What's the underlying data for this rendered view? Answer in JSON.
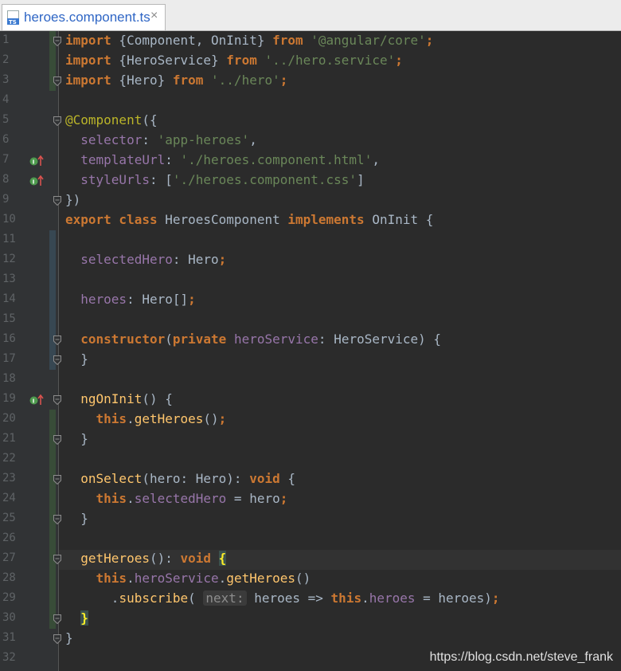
{
  "tab": {
    "filename": "heroes.component.ts",
    "file_icon": "ts-file-icon",
    "close_glyph": "×"
  },
  "watermark": "https://blog.csdn.net/steve_frank",
  "lines": [
    {
      "num": "1",
      "html": "<span class=\"k\">import</span> {Component, OnInit} <span class=\"k\">from</span> <span class=\"s\">'@angular/core'</span><span class=\"k\">;</span>"
    },
    {
      "num": "2",
      "html": "<span class=\"k\">import</span> {HeroService} <span class=\"k\">from</span> <span class=\"s\">'../hero.service'</span><span class=\"k\">;</span>"
    },
    {
      "num": "3",
      "html": "<span class=\"k\">import</span> {Hero} <span class=\"k\">from</span> <span class=\"s\">'../hero'</span><span class=\"k\">;</span>"
    },
    {
      "num": "4",
      "html": ""
    },
    {
      "num": "5",
      "html": "<span class=\"a\">@Component</span>({"
    },
    {
      "num": "6",
      "html": "  <span class=\"v\">selector</span>: <span class=\"s\">'app-heroes'</span>,"
    },
    {
      "num": "7",
      "html": "  <span class=\"v\">templateUrl</span>: <span class=\"s\">'./heroes.component.html'</span>,"
    },
    {
      "num": "8",
      "html": "  <span class=\"v\">styleUrls</span>: [<span class=\"s\">'./heroes.component.css'</span>]"
    },
    {
      "num": "9",
      "html": "})"
    },
    {
      "num": "10",
      "html": "<span class=\"k\">export class</span> HeroesComponent <span class=\"k\">implements</span> OnInit {"
    },
    {
      "num": "11",
      "html": ""
    },
    {
      "num": "12",
      "html": "  <span class=\"v\">selectedHero</span>: Hero<span class=\"k\">;</span>"
    },
    {
      "num": "13",
      "html": ""
    },
    {
      "num": "14",
      "html": "  <span class=\"v\">heroes</span>: Hero[]<span class=\"k\">;</span>"
    },
    {
      "num": "15",
      "html": ""
    },
    {
      "num": "16",
      "html": "  <span class=\"k\">constructor</span>(<span class=\"k\">private</span> <span class=\"v\">heroService</span>: HeroService) {"
    },
    {
      "num": "17",
      "html": "  }"
    },
    {
      "num": "18",
      "html": ""
    },
    {
      "num": "19",
      "html": "  <span class=\"f\">ngOnInit</span>() {"
    },
    {
      "num": "20",
      "html": "    <span class=\"k\">this</span>.<span class=\"f\">getHeroes</span>()<span class=\"k\">;</span>"
    },
    {
      "num": "21",
      "html": "  }"
    },
    {
      "num": "22",
      "html": ""
    },
    {
      "num": "23",
      "html": "  <span class=\"f\">onSelect</span>(hero: Hero): <span class=\"k\">void</span> {"
    },
    {
      "num": "24",
      "html": "    <span class=\"k\">this</span>.<span class=\"v\">selectedHero</span> = hero<span class=\"k\">;</span>"
    },
    {
      "num": "25",
      "html": "  }"
    },
    {
      "num": "26",
      "html": ""
    },
    {
      "num": "27",
      "html": "  <span class=\"f\">getHeroes</span>(): <span class=\"k\">void</span> <span class=\"brace-hl\">{</span>"
    },
    {
      "num": "28",
      "html": "    <span class=\"k\">this</span>.<span class=\"v\">heroService</span>.<span class=\"f\">getHeroes</span>()"
    },
    {
      "num": "29",
      "html": "      .<span class=\"f\">subscribe</span>( <span class=\"hint\">next:</span> heroes => <span class=\"k\">this</span>.<span class=\"v\">heroes</span> = heroes)<span class=\"k\">;</span>"
    },
    {
      "num": "30",
      "html": "  <span class=\"brace-hl\">}</span>"
    },
    {
      "num": "31",
      "html": "}"
    },
    {
      "num": "32",
      "html": ""
    }
  ],
  "gutter_markers": [
    {
      "line": 7,
      "icon": "implementing-method-icon"
    },
    {
      "line": 8,
      "icon": "implementing-method-icon"
    },
    {
      "line": 19,
      "icon": "implementing-method-icon"
    }
  ],
  "fold_markers": [
    1,
    3,
    5,
    9,
    16,
    17,
    19,
    21,
    23,
    25,
    27,
    30,
    31
  ],
  "current_line": 27,
  "colors": {
    "background": "#2b2b2b",
    "keyword": "#cc7832",
    "string": "#6a8759",
    "function": "#ffc66d",
    "field": "#9876aa",
    "annotation": "#bbb529",
    "text": "#a9b7c6"
  }
}
